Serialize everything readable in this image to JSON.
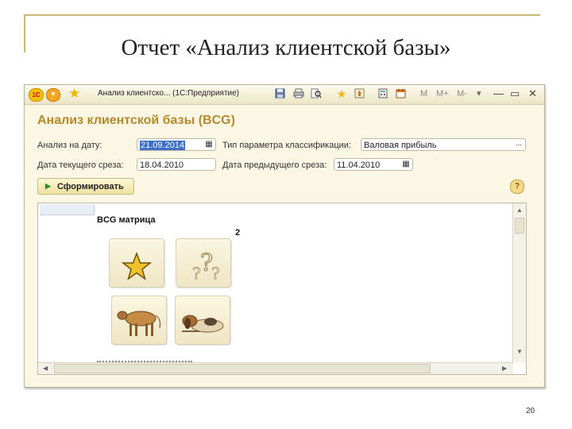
{
  "slide": {
    "title": "Отчет «Анализ клиентской базы»",
    "number": "20"
  },
  "window": {
    "title": "Анализ клиентско... (1С:Предприятие)",
    "logo_text": "1С",
    "letters": [
      "M",
      "M+",
      "M-"
    ],
    "icons": [
      "logo-icon",
      "menu-icon",
      "favorite-star-icon",
      "save-icon",
      "print-icon",
      "preview-icon",
      "add-favorite-icon",
      "history-icon",
      "calculator-icon",
      "calendar-icon",
      "minimize-icon",
      "restore-icon",
      "close-icon"
    ]
  },
  "form": {
    "title": "Анализ клиентской базы (BCG)",
    "analysis_date_label": "Анализ на дату:",
    "analysis_date_value": "21.09.2014",
    "param_type_label": "Тип параметра классификации:",
    "param_type_value": "Валовая прибыль",
    "current_slice_label": "Дата текущего среза:",
    "current_slice_value": "18.04.2010",
    "prev_slice_label": "Дата предыдущего среза:",
    "prev_slice_value": "11.04.2010",
    "generate_button": "Сформировать",
    "help_symbol": "?"
  },
  "report": {
    "heading": "BCG матрица",
    "number": "2",
    "quadrants": [
      {
        "name": "star",
        "icon": "star-icon"
      },
      {
        "name": "question",
        "icon": "question-marks-icon"
      },
      {
        "name": "cash-cow",
        "icon": "cow-icon"
      },
      {
        "name": "dog",
        "icon": "dog-icon"
      }
    ]
  },
  "colors": {
    "form_title": "#b58a2c",
    "selection": "#3d6fc7",
    "window_bg": "#fbf7e4",
    "frame_accent": "#c9b87a"
  }
}
